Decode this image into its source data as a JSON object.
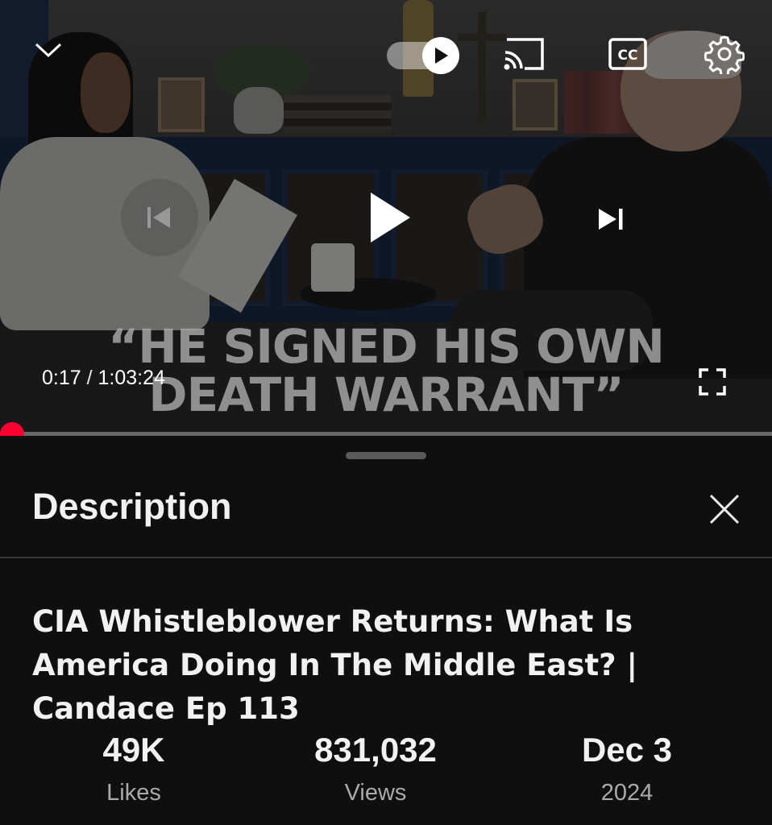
{
  "player": {
    "caption_line1": "“HE SIGNED HIS OWN",
    "caption_line2": "DEATH WARRANT”",
    "current_time": "0:17",
    "separator": " / ",
    "duration": "1:03:24",
    "progress_fraction": 0.0045,
    "autoplay": true,
    "icons": {
      "collapse": "chevron-down-icon",
      "autoplay": "play-icon",
      "cast": "cast-icon",
      "captions": "cc-icon",
      "settings": "gear-icon",
      "previous": "skip-previous-icon",
      "play": "play-icon",
      "next": "skip-next-icon",
      "fullscreen": "fullscreen-icon"
    },
    "accent_color": "#ff0033"
  },
  "panel": {
    "title": "Description",
    "close_icon": "close-icon",
    "video_title": "CIA Whistleblower Returns: What Is America Doing In The Middle East? | Candace Ep 113",
    "stats": {
      "likes_value": "49K",
      "likes_label": "Likes",
      "views_value": "831,032",
      "views_label": "Views",
      "date_value": "Dec 3",
      "date_label": "2024"
    }
  }
}
